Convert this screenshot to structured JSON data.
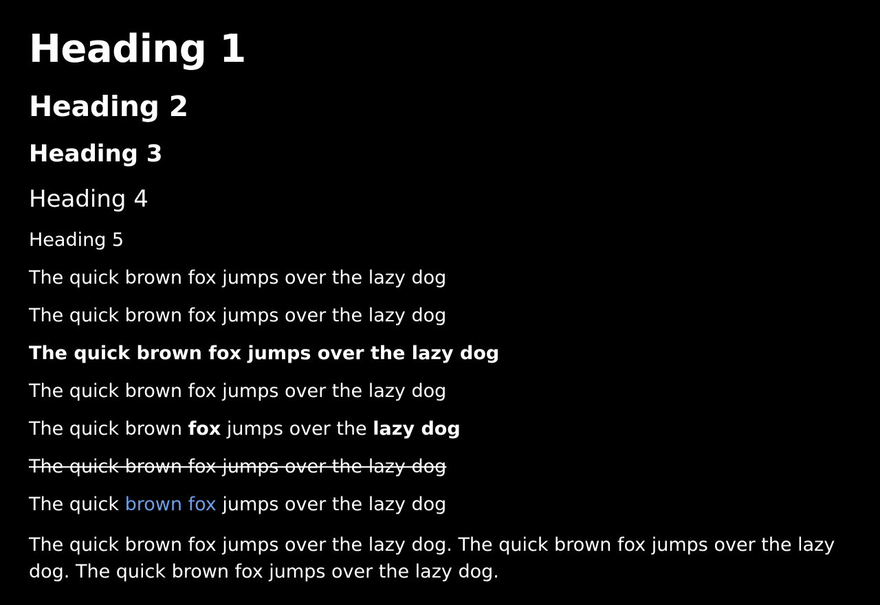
{
  "headings": {
    "h1": "Heading 1",
    "h2": "Heading 2",
    "h3": "Heading 3",
    "h4": "Heading 4",
    "h5": "Heading 5"
  },
  "paragraphs": {
    "p1": "The quick brown fox jumps over the lazy dog",
    "p2": "The quick brown fox jumps over the lazy dog",
    "p3_bold": "The quick brown fox jumps over the lazy dog",
    "p4": "The quick brown fox jumps over the lazy dog",
    "p5": {
      "part1": "The quick brown ",
      "bold1": "fox",
      "part2": " jumps over the ",
      "bold2": "lazy dog"
    },
    "p6_strikethrough": "The quick brown fox jumps over the lazy dog",
    "p7": {
      "before": "The quick ",
      "link": "brown fox",
      "after": " jumps over the lazy dog"
    },
    "long": "The quick brown fox jumps over the lazy dog. The quick brown fox jumps over the lazy dog. The quick brown fox jumps over the lazy dog."
  },
  "colors": {
    "background": "#000000",
    "text": "#ffffff",
    "link": "#6b9fea"
  }
}
